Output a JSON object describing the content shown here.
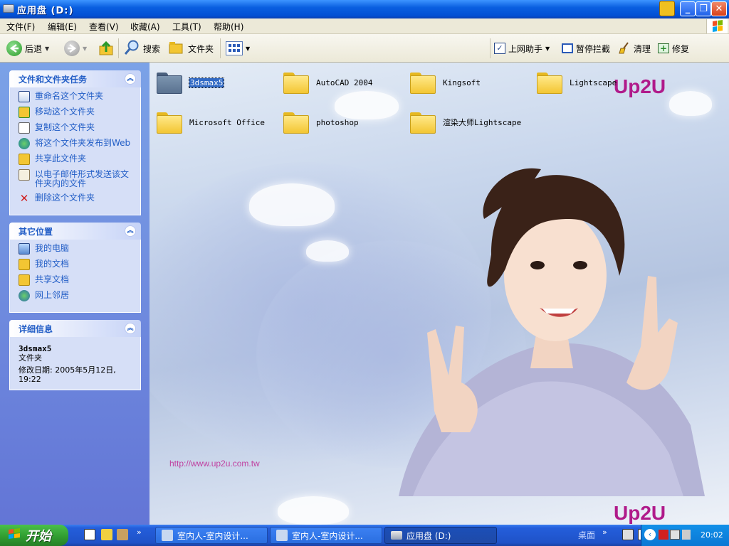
{
  "window": {
    "title": "应用盘 (D:)"
  },
  "menus": [
    "文件(F)",
    "编辑(E)",
    "查看(V)",
    "收藏(A)",
    "工具(T)",
    "帮助(H)"
  ],
  "toolbar": {
    "back": "后退",
    "search": "搜索",
    "folders": "文件夹",
    "plugin1": "上网助手",
    "plugin2": "暂停拦截",
    "plugin3": "清理",
    "plugin4": "修复"
  },
  "sidebar": {
    "tasks": {
      "title": "文件和文件夹任务",
      "items": [
        "重命名这个文件夹",
        "移动这个文件夹",
        "复制这个文件夹",
        "将这个文件夹发布到Web",
        "共享此文件夹",
        "以电子邮件形式发送该文件夹内的文件",
        "删除这个文件夹"
      ]
    },
    "places": {
      "title": "其它位置",
      "items": [
        "我的电脑",
        "我的文档",
        "共享文档",
        "网上邻居"
      ]
    },
    "details": {
      "title": "详细信息",
      "name": "3dsmax5",
      "type": "文件夹",
      "modified": "修改日期: 2005年5月12日, 19:22"
    }
  },
  "folders": [
    "3dsmax5",
    "AutoCAD 2004",
    "Kingsoft",
    "Lightscape",
    "Microsoft Office",
    "photoshop",
    "渲染大师Lightscape"
  ],
  "wallpaper": {
    "brand": "Up2U",
    "url": "http://www.up2u.com.tw"
  },
  "taskbar": {
    "start": "开始",
    "tasks": [
      "室内人-室内设计...",
      "室内人-室内设计...",
      "应用盘 (D:)"
    ],
    "desktop": "桌面",
    "clock": "20:02"
  }
}
